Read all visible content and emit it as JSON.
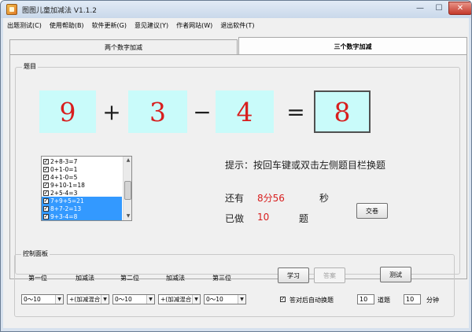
{
  "window": {
    "title": "图图儿童加减法 V1.1.2"
  },
  "menu": [
    "出题测试(C)",
    "使用帮助(B)",
    "软件更新(G)",
    "意见建议(Y)",
    "作者网站(W)",
    "退出软件(T)"
  ],
  "tabs": [
    {
      "label": "两个数字加减",
      "active": false
    },
    {
      "label": "三个数字加减",
      "active": true
    }
  ],
  "question_group": {
    "title": "题目"
  },
  "equation": {
    "n1": "9",
    "op1": "+",
    "n2": "3",
    "op2": "−",
    "n3": "4",
    "eq": "=",
    "answer": "8"
  },
  "history": [
    {
      "text": "2+8-3=7",
      "checked": true,
      "selected": false
    },
    {
      "text": "0+1-0=1",
      "checked": true,
      "selected": false
    },
    {
      "text": "4+1-0=5",
      "checked": true,
      "selected": false
    },
    {
      "text": "9+10-1=18",
      "checked": true,
      "selected": false
    },
    {
      "text": "2+5-4=3",
      "checked": true,
      "selected": false
    },
    {
      "text": "7+9+5=21",
      "checked": true,
      "selected": true
    },
    {
      "text": "8+7-2=13",
      "checked": true,
      "selected": true
    },
    {
      "text": "9+3-4=8",
      "checked": true,
      "selected": true
    }
  ],
  "hint": "提示：按回车键或双击左侧题目栏换题",
  "stats": {
    "remaining_label": "还有",
    "remaining_value": "8分56",
    "remaining_unit": "秒",
    "done_label": "已做",
    "done_value": "10",
    "done_unit": "题"
  },
  "submit_label": "交卷",
  "control_panel": {
    "title": "控制面板",
    "labels": [
      "第一位",
      "加减法",
      "第二位",
      "加减法",
      "第三位"
    ],
    "combos": [
      "0～10",
      "+(加减混合",
      "0～10",
      "+(加减混合",
      "0～10"
    ],
    "study_label": "学习",
    "answer_label": "答案",
    "test_label": "测试",
    "auto_switch_label": "答对后自动换题",
    "auto_switch_checked": true,
    "count_value": "10",
    "count_unit": "道题",
    "time_value": "10",
    "time_unit": "分钟"
  },
  "colors": {
    "number_text": "#d81e1e",
    "number_bg": "#c9fbfa",
    "selection": "#3399ff"
  }
}
